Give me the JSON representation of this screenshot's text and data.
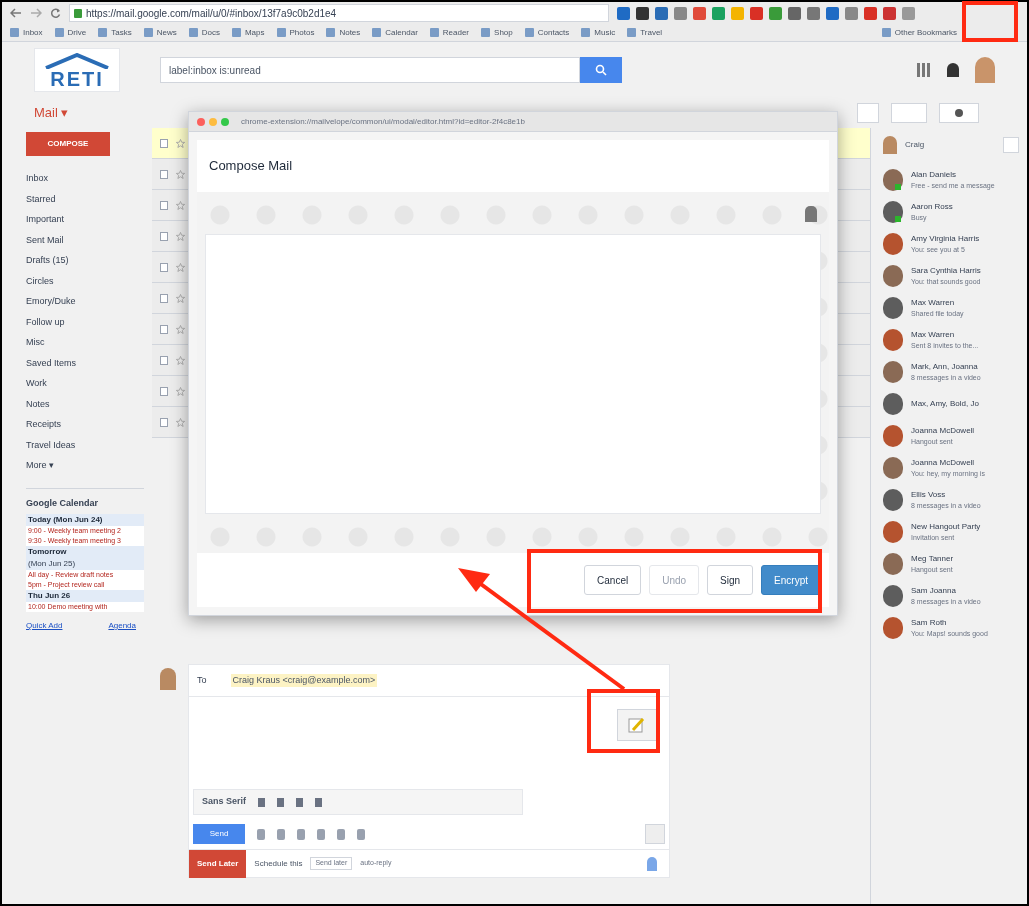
{
  "browser": {
    "url": "https://mail.google.com/mail/u/0/#inbox/13f7a9c0b2d1e4",
    "bookmarks": [
      "Inbox",
      "Drive",
      "Tasks",
      "News",
      "Docs",
      "Maps",
      "Photos",
      "Notes",
      "Calendar",
      "Reader",
      "Shop",
      "Contacts",
      "Music",
      "Travel",
      "Other Bookmarks"
    ]
  },
  "header": {
    "logo": "RETI",
    "search_value": "label:inbox is:unread",
    "app": "Mail ▾"
  },
  "sidebar": {
    "compose": "COMPOSE",
    "labels": [
      {
        "label": "Inbox",
        "selected": false
      },
      {
        "label": "Starred",
        "selected": false
      },
      {
        "label": "Important",
        "selected": false
      },
      {
        "label": "Sent Mail",
        "selected": false
      },
      {
        "label": "Drafts (15)",
        "selected": false
      },
      {
        "label": "Circles",
        "selected": false
      },
      {
        "label": "Emory/Duke",
        "selected": false
      },
      {
        "label": "Follow up",
        "selected": false
      },
      {
        "label": "Misc",
        "selected": false
      },
      {
        "label": "Saved Items",
        "selected": false
      },
      {
        "label": "Work",
        "selected": false
      },
      {
        "label": "Notes",
        "selected": false
      },
      {
        "label": "Receipts",
        "selected": false
      },
      {
        "label": "Travel Ideas",
        "selected": false
      },
      {
        "label": "More ▾",
        "selected": false
      }
    ],
    "calendar": {
      "title": "Google Calendar",
      "days": [
        {
          "day": "Today (Mon Jun 24)",
          "events": [
            "9:00 - Weekly team meeting 2",
            "9:30 - Weekly team meeting 3"
          ]
        },
        {
          "day": "Tomorrow",
          "note": "(Mon Jun 25)",
          "events": [
            "All day - Review draft notes",
            "5pm - Project review call"
          ]
        },
        {
          "day": "Thu Jun 26",
          "events": [
            "10:00 Demo meeting with"
          ]
        }
      ],
      "links": [
        "Quick Add",
        "Agenda"
      ]
    }
  },
  "mail_rows": [
    {
      "unread": true,
      "checked": false
    },
    {
      "unread": false,
      "checked": false
    },
    {
      "unread": false,
      "checked": false
    },
    {
      "unread": false,
      "checked": false
    },
    {
      "unread": false,
      "checked": false
    },
    {
      "unread": false,
      "checked": false
    },
    {
      "unread": false,
      "checked": false
    },
    {
      "unread": false,
      "checked": false
    },
    {
      "unread": false,
      "checked": false
    },
    {
      "unread": false,
      "checked": false
    }
  ],
  "dialog": {
    "url": "chrome-extension://mailvelope/common/ui/modal/editor.html?id=editor-2f4c8e1b",
    "title": "Compose Mail",
    "buttons": [
      {
        "label": "Cancel",
        "kind": "default"
      },
      {
        "label": "Undo",
        "kind": "disabled"
      },
      {
        "label": "Sign",
        "kind": "default"
      },
      {
        "label": "Encrypt",
        "kind": "primary"
      }
    ]
  },
  "reply": {
    "to_label": "To",
    "recipient": "Craig Kraus <craig@example.com>",
    "format_font": "Sans Serif",
    "send": "Send",
    "send_later": "Send Later",
    "options": "Schedule this",
    "tooltip": "Send later",
    "autoreply": "auto-reply"
  },
  "chat": {
    "me": "Craig",
    "contacts": [
      {
        "name": "Alan Daniels",
        "status": "Free - send me a message",
        "online": true
      },
      {
        "name": "Aaron Ross",
        "status": "Busy",
        "online": true
      },
      {
        "name": "Amy Virginia Harris",
        "status": "You: see you at 5",
        "online": false
      },
      {
        "name": "Sara Cynthia Harris",
        "status": "You: that sounds good",
        "online": false
      },
      {
        "name": "Max Warren",
        "status": "Shared file today",
        "online": false
      },
      {
        "name": "Max Warren",
        "status": "Sent 8 invites to the...",
        "online": false
      },
      {
        "name": "Mark, Ann, Joanna",
        "status": "8 messages in a video",
        "online": false
      },
      {
        "name": "Max, Amy, Bold, Jo",
        "online": false
      },
      {
        "name": "Joanna McDowell",
        "status": "Hangout sent",
        "online": false
      },
      {
        "name": "Joanna McDowell",
        "status": "You: hey, my morning is",
        "online": false
      },
      {
        "name": "Ellis Voss",
        "status": "8 messages in a video",
        "online": false
      },
      {
        "name": "New Hangout Party",
        "status": "Invitation sent",
        "online": false
      },
      {
        "name": "Meg Tanner",
        "status": "Hangout sent",
        "online": false
      },
      {
        "name": "Sam Joanna",
        "status": "8 messages in a video",
        "online": false
      },
      {
        "name": "Sam Roth",
        "status": "You: Maps! sounds good",
        "online": false
      }
    ]
  }
}
